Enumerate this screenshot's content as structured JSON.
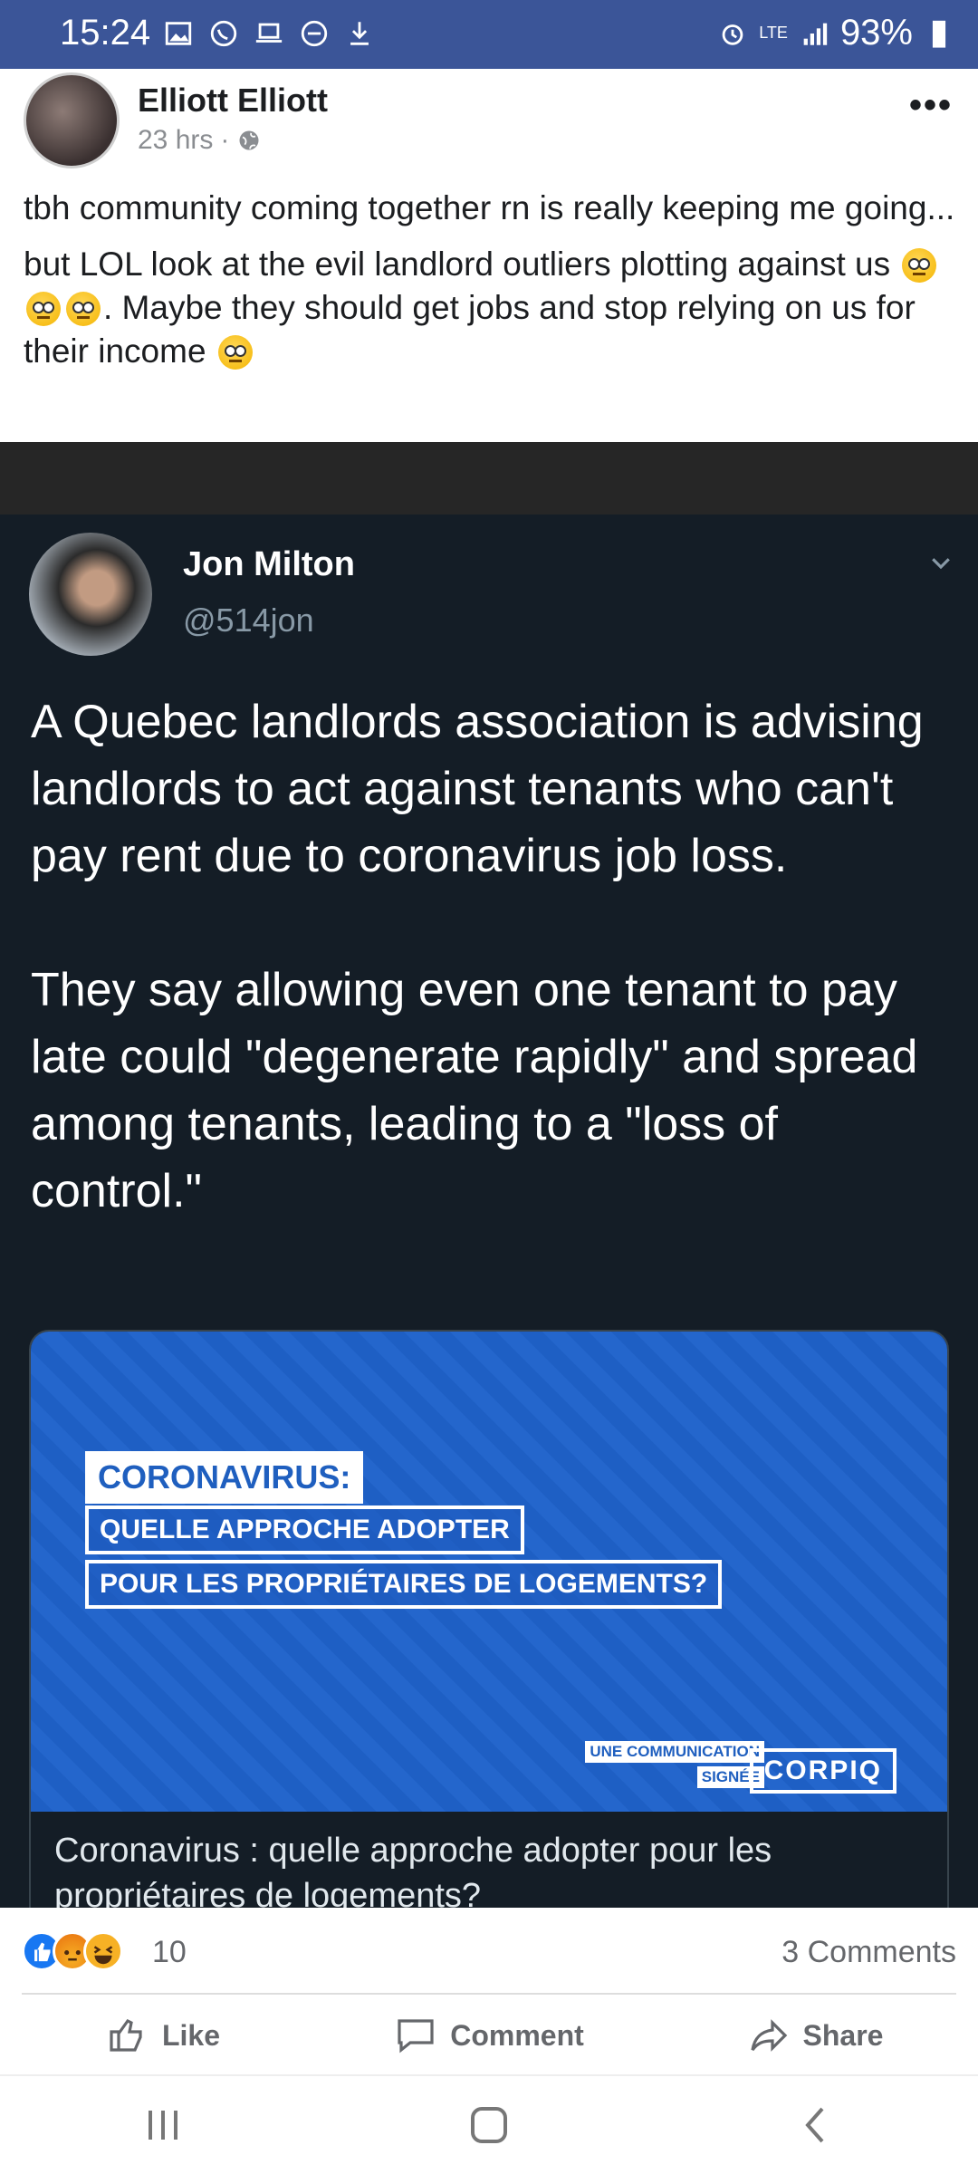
{
  "status_bar": {
    "time": "15:24",
    "battery": "93%",
    "network": "LTE"
  },
  "post": {
    "author": "Elliott Elliott",
    "time": "23 hrs",
    "paragraph1": "tbh community coming together rn is really keeping me going...",
    "paragraph2_a": "but LOL look at the evil landlord outliers plotting against us",
    "paragraph2_b": ". Maybe they should get jobs and stop relying on us for their income"
  },
  "tweet": {
    "name": "Jon Milton",
    "handle": "@514jon",
    "body1": "A Quebec landlords association is advising landlords to act against tenants who can't pay rent due to coronavirus job loss.",
    "body2": "They say allowing even one tenant to pay late could \"degenerate rapidly\" and spread among tenants, leading to a \"loss of control.\"",
    "card": {
      "title": "CORONAVIRUS:",
      "line1": "QUELLE APPROCHE ADOPTER",
      "line2": "POUR LES PROPRIÉTAIRES DE LOGEMENTS?",
      "sign1": "UNE COMMUNICATION",
      "sign2": "SIGNÉE",
      "brand": "CORPIQ",
      "caption": "Coronavirus : quelle approche adopter pour les propriétaires de logements?"
    }
  },
  "reactions": {
    "count": "10",
    "comments": "3 Comments"
  },
  "actions": {
    "like": "Like",
    "comment": "Comment",
    "share": "Share"
  }
}
